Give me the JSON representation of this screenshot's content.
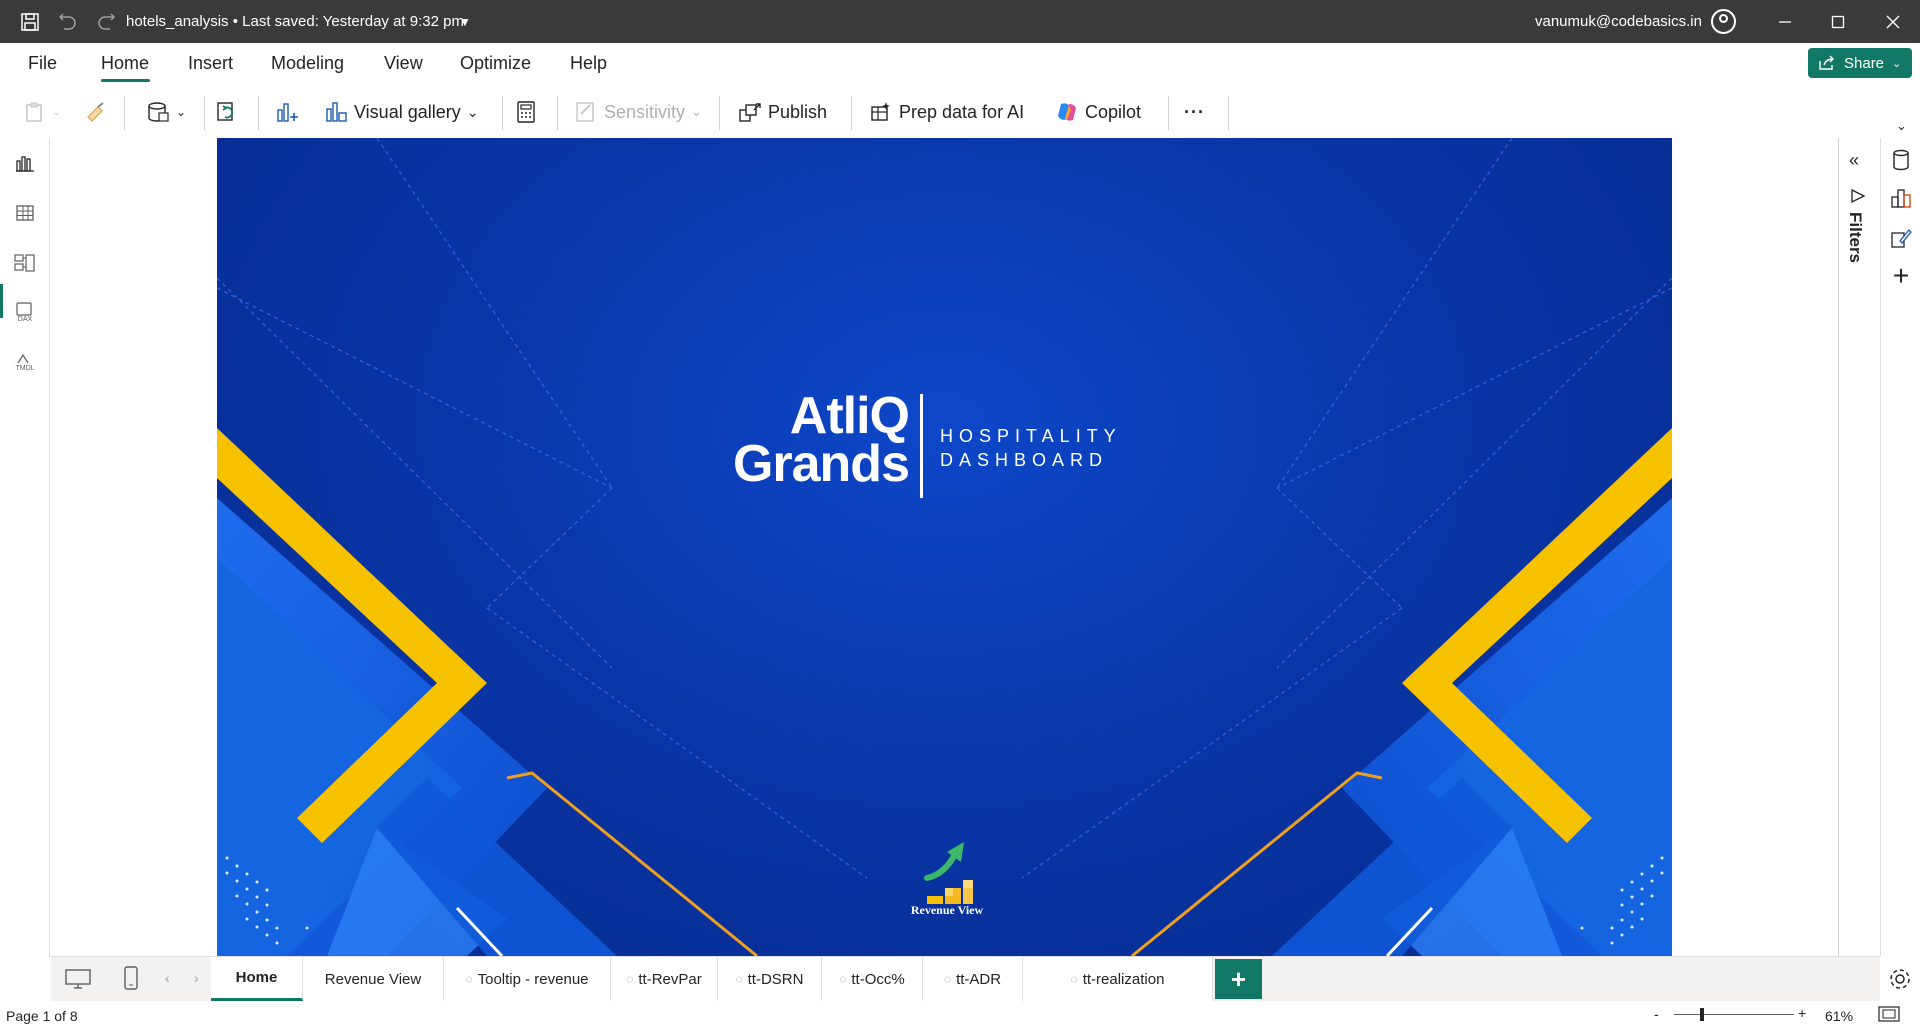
{
  "titlebar": {
    "file_name": "hotels_analysis",
    "save_status": "Last saved: Yesterday at 9:32 pm",
    "user_email": "vanumuk@codebasics.in"
  },
  "menu": {
    "tabs": [
      "File",
      "Home",
      "Insert",
      "Modeling",
      "View",
      "Optimize",
      "Help"
    ],
    "active_tab": "Home",
    "share_label": "Share"
  },
  "ribbon": {
    "visual_gallery": "Visual gallery",
    "sensitivity": "Sensitivity",
    "publish": "Publish",
    "prep_data": "Prep data for AI",
    "copilot": "Copilot",
    "more": "···"
  },
  "leftnav": {
    "items": [
      "report-view-icon",
      "table-view-icon",
      "model-view-icon",
      "dax-query-icon",
      "tmdl-view-icon"
    ],
    "dax_text": "DAX",
    "tmdl_text": "TMDL"
  },
  "report": {
    "brand_line1": "AtliQ",
    "brand_line2": "Grands",
    "tagline1": "HOSPITALITY",
    "tagline2": "DASHBOARD",
    "nav_button_label": "Revenue View",
    "colors": {
      "background": "#0a36a8",
      "accent_yellow": "#f6c200",
      "accent_orange": "#f0a020",
      "panel_blue": "#1565e0"
    }
  },
  "filters": {
    "label": "Filters"
  },
  "pages": {
    "tabs": [
      {
        "label": "Home",
        "hidden": false,
        "active": true
      },
      {
        "label": "Revenue View",
        "hidden": false,
        "active": false
      },
      {
        "label": "Tooltip - revenue",
        "hidden": true,
        "active": false
      },
      {
        "label": "tt-RevPar",
        "hidden": true,
        "active": false
      },
      {
        "label": "tt-DSRN",
        "hidden": true,
        "active": false
      },
      {
        "label": "tt-Occ%",
        "hidden": true,
        "active": false
      },
      {
        "label": "tt-ADR",
        "hidden": true,
        "active": false
      },
      {
        "label": "tt-realization",
        "hidden": true,
        "active": false
      }
    ],
    "add_label": "+"
  },
  "status": {
    "page_indicator": "Page 1 of 8",
    "zoom_minus": "-",
    "zoom_plus": "+",
    "zoom_level": "61%"
  }
}
